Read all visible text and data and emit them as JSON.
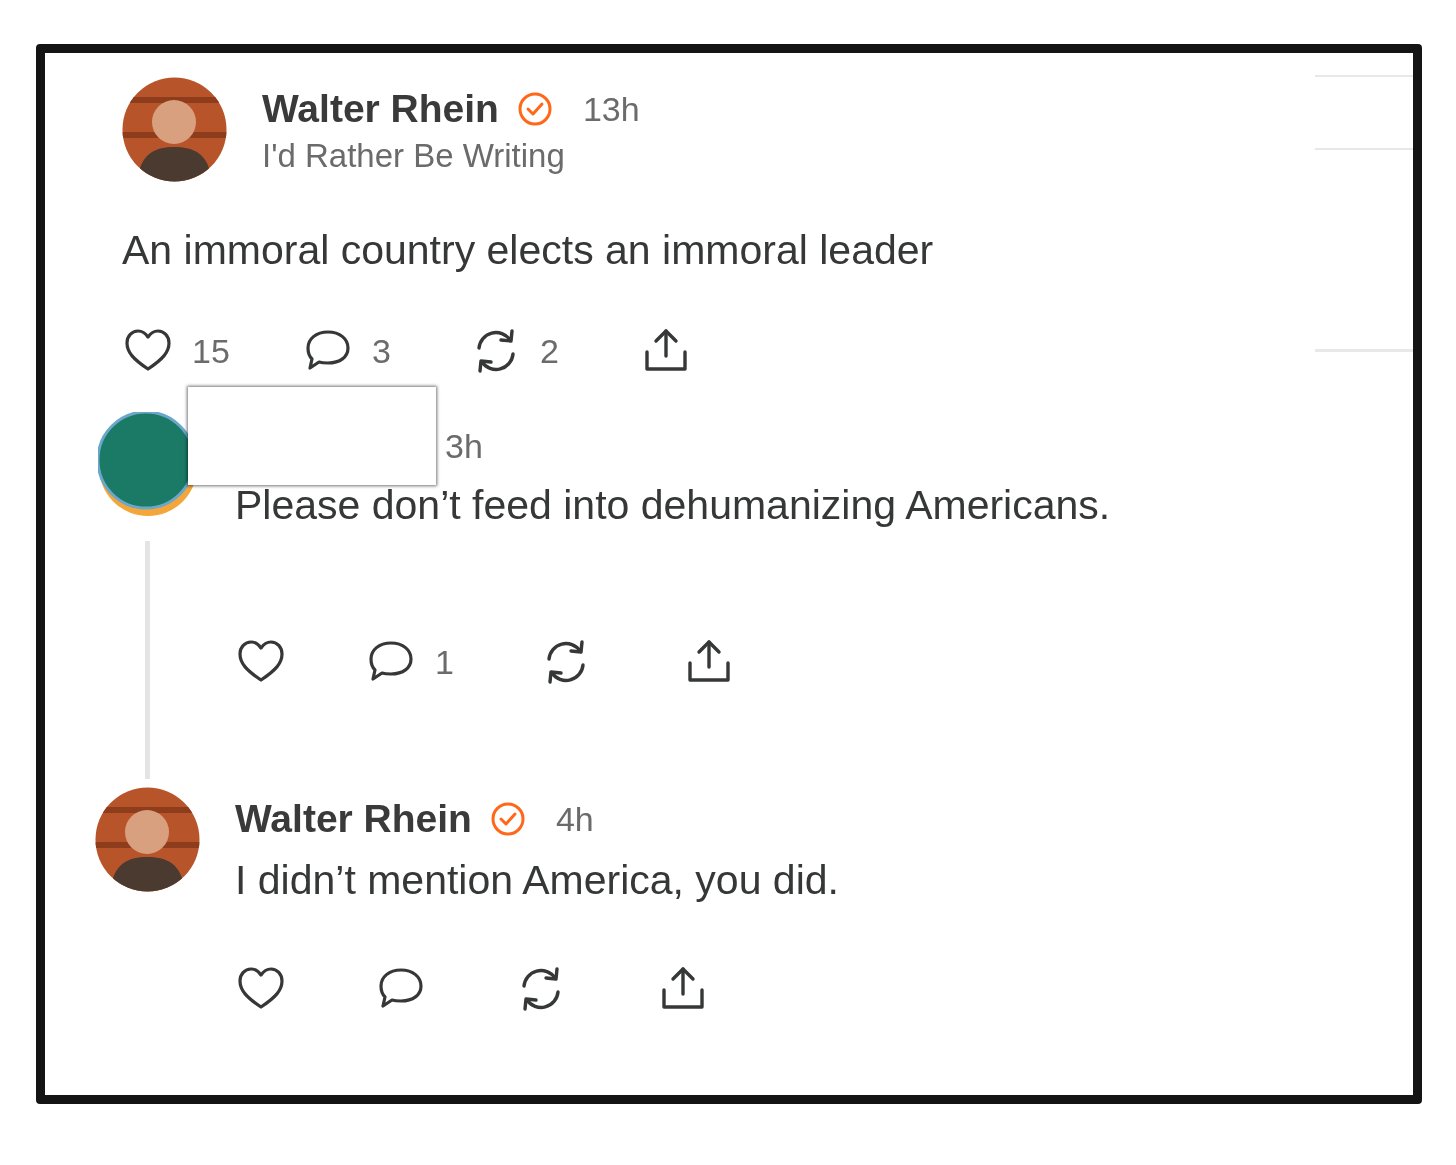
{
  "post": {
    "author": "Walter Rhein",
    "verified": true,
    "time": "13h",
    "publication": "I'd Rather Be Writing",
    "text": "An immoral country elects an immoral leader",
    "actions": [
      {
        "kind": "like",
        "count": "15"
      },
      {
        "kind": "comment",
        "count": "3"
      },
      {
        "kind": "restack",
        "count": "2"
      },
      {
        "kind": "share"
      }
    ]
  },
  "replies": [
    {
      "kind": "redacted",
      "author_redacted": true,
      "time": "3h",
      "text": "Please don’t feed into dehumanizing Americans.",
      "thread_line": true,
      "actions": [
        {
          "kind": "like"
        },
        {
          "kind": "comment",
          "count": "1"
        },
        {
          "kind": "restack"
        },
        {
          "kind": "share"
        }
      ]
    },
    {
      "kind": "named",
      "author": "Walter Rhein",
      "verified": true,
      "time": "4h",
      "text": "I didn’t mention America, you did.",
      "thread_line": false,
      "actions": [
        {
          "kind": "like"
        },
        {
          "kind": "comment"
        },
        {
          "kind": "restack"
        },
        {
          "kind": "share"
        }
      ]
    }
  ]
}
